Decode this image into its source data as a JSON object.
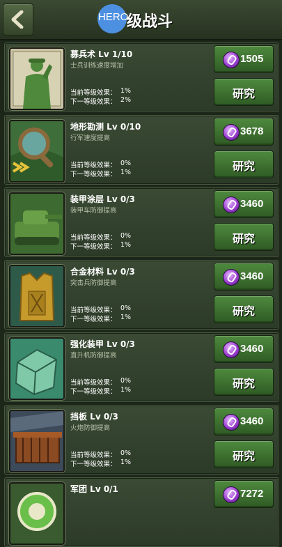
{
  "header": {
    "hero_badge": "HERO",
    "title": "级战斗"
  },
  "labels": {
    "current_effect": "当前等级效果：",
    "next_effect": "下一等级效果：",
    "research": "研究"
  },
  "colors": {
    "gem": "#9b3fd0",
    "button_green": "#4e8a3e",
    "hero_circle": "#4d8fe0"
  },
  "upgrades": [
    {
      "name": "募兵术 Lv 1/10",
      "desc": "士兵训练速度增加",
      "current": "1%",
      "next": "2%",
      "cost": "1505",
      "icon": "soldier-salute-icon"
    },
    {
      "name": "地形勘测 Lv 0/10",
      "desc": "行军速度提高",
      "current": "0%",
      "next": "1%",
      "cost": "3678",
      "icon": "magnifier-map-icon"
    },
    {
      "name": "装甲涂层 Lv 0/3",
      "desc": "装甲车防御提高",
      "current": "0%",
      "next": "1%",
      "cost": "3460",
      "icon": "tank-icon"
    },
    {
      "name": "合金材料 Lv 0/3",
      "desc": "突击兵防御提高",
      "current": "0%",
      "next": "1%",
      "cost": "3460",
      "icon": "armor-vest-icon"
    },
    {
      "name": "强化装甲 Lv 0/3",
      "desc": "直升机防御提高",
      "current": "0%",
      "next": "1%",
      "cost": "3460",
      "icon": "armor-plate-icon"
    },
    {
      "name": "挡板 Lv 0/3",
      "desc": "火炮防御提高",
      "current": "0%",
      "next": "1%",
      "cost": "3460",
      "icon": "barrier-icon"
    },
    {
      "name": "军团 Lv 0/1",
      "desc": "",
      "current": "",
      "next": "",
      "cost": "7272",
      "icon": "legion-badge-icon"
    }
  ]
}
